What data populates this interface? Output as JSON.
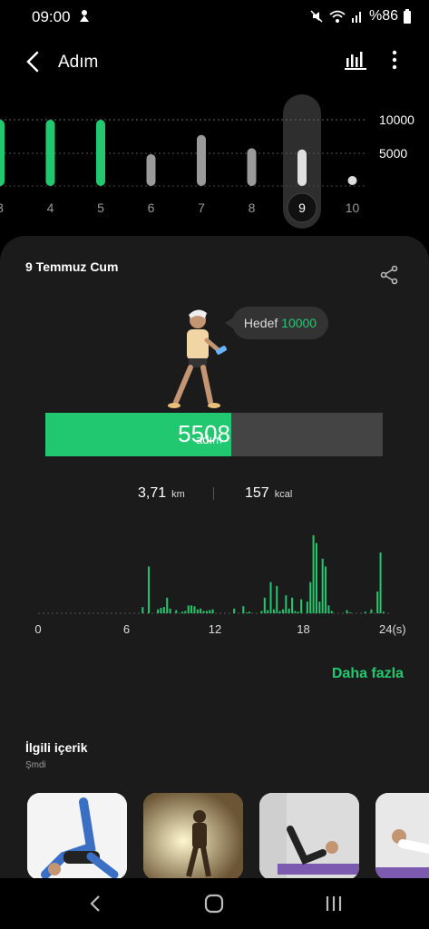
{
  "status": {
    "time": "09:00",
    "battery": "%86"
  },
  "appbar": {
    "title": "Adım"
  },
  "day_chart": {
    "days": [
      "3",
      "4",
      "5",
      "6",
      "7",
      "8",
      "9",
      "10"
    ],
    "selected": "9",
    "levels": [
      {
        "label": "10000"
      },
      {
        "label": "5000"
      }
    ],
    "goal": 10000,
    "values": [
      10000,
      10000,
      10000,
      4800,
      7700,
      5700,
      5508,
      0
    ]
  },
  "summary": {
    "date": "9 Temmuz Cum",
    "goal_label": "Hedef",
    "goal_value": "10000",
    "steps": "5508",
    "steps_unit": "adım",
    "progress": 0.55,
    "distance": "3,71",
    "distance_unit": "km",
    "calories": "157",
    "calories_unit": "kcal"
  },
  "chart_data": {
    "type": "bar",
    "xlabel": "",
    "ylabel": "",
    "x_ticks": [
      "0",
      "6",
      "12",
      "18",
      "24(s)"
    ],
    "bins_per_hour": 4,
    "values": [
      0,
      0,
      0,
      0,
      0,
      0,
      0,
      0,
      0,
      0,
      0,
      0,
      0,
      0,
      0,
      0,
      0,
      0,
      0,
      0,
      0,
      0,
      0,
      0,
      0,
      0,
      0,
      0,
      0,
      0,
      0,
      0,
      0,
      0,
      8,
      0,
      60,
      0,
      0,
      5,
      7,
      8,
      20,
      6,
      0,
      4,
      0,
      2,
      3,
      10,
      10,
      9,
      5,
      6,
      3,
      3,
      4,
      5,
      0,
      0,
      0,
      0,
      0,
      0,
      6,
      0,
      0,
      9,
      1,
      2,
      0,
      0,
      0,
      3,
      20,
      4,
      40,
      5,
      35,
      3,
      5,
      23,
      6,
      20,
      3,
      2,
      18,
      0,
      15,
      40,
      100,
      90,
      15,
      70,
      60,
      10,
      3,
      0,
      0,
      0,
      0,
      4,
      1,
      0,
      0,
      0,
      0,
      2,
      0,
      5,
      0,
      28,
      78,
      2,
      0,
      0
    ]
  },
  "more": "Daha fazla",
  "related": {
    "title": "İlgili içerik",
    "subtitle": "Şmdi"
  }
}
